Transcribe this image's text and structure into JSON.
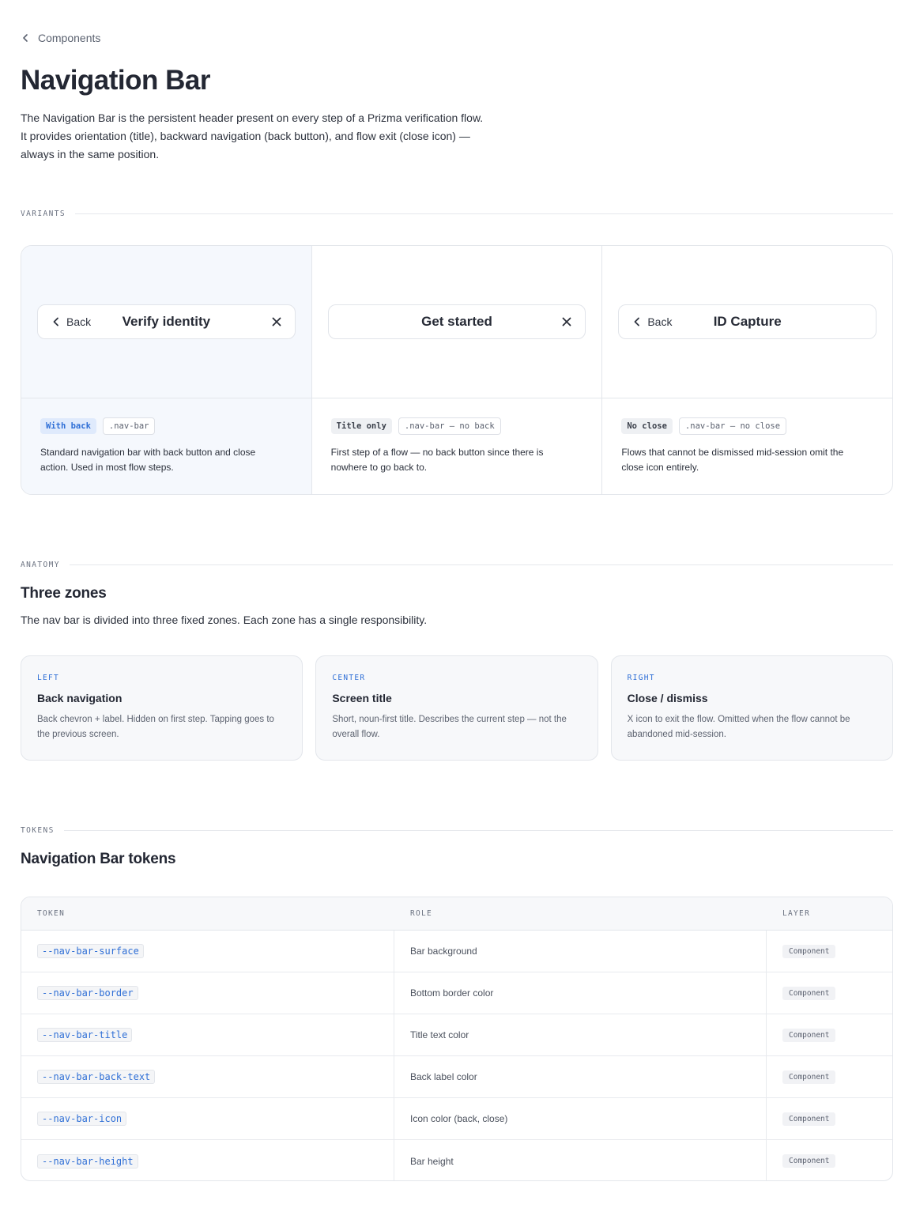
{
  "breadcrumb": {
    "label": "Components"
  },
  "page": {
    "title": "Navigation Bar",
    "intro": "The Navigation Bar is the persistent header present on every step of a Prizma verification flow. It provides orientation (title), backward navigation (back button), and flow exit (close icon) — always in the same position."
  },
  "sections": {
    "variants": "VARIANTS",
    "anatomy": "ANATOMY",
    "tokens": "TOKENS"
  },
  "variants": [
    {
      "back": "Back",
      "title": "Verify identity",
      "tag": "With back",
      "class": ".nav-bar",
      "desc": "Standard navigation bar with back button and close action. Used in most flow steps."
    },
    {
      "title": "Get started",
      "tag": "Title only",
      "class": ".nav-bar — no back",
      "desc": "First step of a flow — no back button since there is nowhere to go back to."
    },
    {
      "back": "Back",
      "title": "ID Capture",
      "tag": "No close",
      "class": ".nav-bar — no close",
      "desc": "Flows that cannot be dismissed mid-session omit the close icon entirely."
    }
  ],
  "anatomy": {
    "title": "Three zones",
    "subtitle": "The nav bar is divided into three fixed zones. Each zone has a single responsibility.",
    "zones": [
      {
        "label": "LEFT",
        "title": "Back navigation",
        "desc": "Back chevron + label. Hidden on first step. Tapping goes to the previous screen."
      },
      {
        "label": "CENTER",
        "title": "Screen title",
        "desc": "Short, noun-first title. Describes the current step — not the overall flow."
      },
      {
        "label": "RIGHT",
        "title": "Close / dismiss",
        "desc": "X icon to exit the flow. Omitted when the flow cannot be abandoned mid-session."
      }
    ]
  },
  "tokens": {
    "title": "Navigation Bar tokens",
    "headers": {
      "token": "TOKEN",
      "role": "ROLE",
      "layer": "LAYER"
    },
    "rows": [
      {
        "token": "--nav-bar-surface",
        "role": "Bar background",
        "layer": "Component"
      },
      {
        "token": "--nav-bar-border",
        "role": "Bottom border color",
        "layer": "Component"
      },
      {
        "token": "--nav-bar-title",
        "role": "Title text color",
        "layer": "Component"
      },
      {
        "token": "--nav-bar-back-text",
        "role": "Back label color",
        "layer": "Component"
      },
      {
        "token": "--nav-bar-icon",
        "role": "Icon color (back, close)",
        "layer": "Component"
      },
      {
        "token": "--nav-bar-height",
        "role": "Bar height",
        "layer": "Component"
      }
    ]
  },
  "colors": {
    "accent": "#2f6fd6",
    "border": "#e3e6eb",
    "active_bg": "#f5f8fd"
  }
}
